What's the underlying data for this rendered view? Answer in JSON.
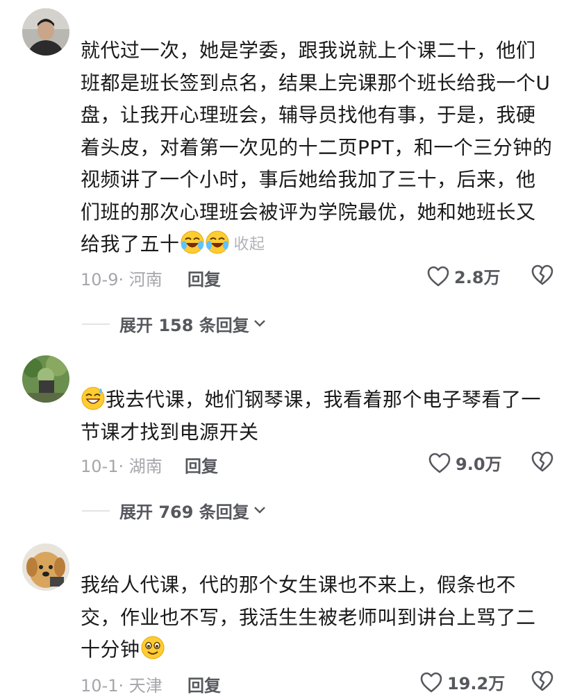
{
  "comments": [
    {
      "text": "就代过一次，她是学委，跟我说就上个课二十，他们班都是班长签到点名，结果上完课那个班长给我一个U盘，让我开心理班会，辅导员找他有事，于是，我硬着头皮，对着第一次见的十二页PPT，和一个三分钟的视频讲了一个小时，事后她给我加了三十，后来，他们班的那次心理班会被评为学院最优，她和她班长又给我了五十",
      "collapse_label": "收起",
      "date_location": "10-9· 河南",
      "reply_label": "回复",
      "likes": "2.8万",
      "expand_label": "展开 158 条回复",
      "trailing_emojis": [
        "rofl-emoji",
        "rofl-emoji"
      ]
    },
    {
      "text": "我去代课，她们钢琴课，我看着那个电子琴看了一节课才找到电源开关",
      "leading_emoji": "sweat-smile-emoji",
      "date_location": "10-1· 湖南",
      "reply_label": "回复",
      "likes": "9.0万",
      "expand_label": "展开 769 条回复"
    },
    {
      "text": "我给人代课，代的那个女生课也不来上，假条也不交，作业也不写，我活生生被老师叫到讲台上骂了二十分钟",
      "trailing_emojis": [
        "smile-emoji"
      ],
      "date_location": "10-1· 天津",
      "reply_label": "回复",
      "likes": "19.2万"
    }
  ],
  "colors": {
    "text": "#1a1a1a",
    "meta": "#a5a6ab",
    "action": "#56585e",
    "divider": "#e3e3e6"
  }
}
